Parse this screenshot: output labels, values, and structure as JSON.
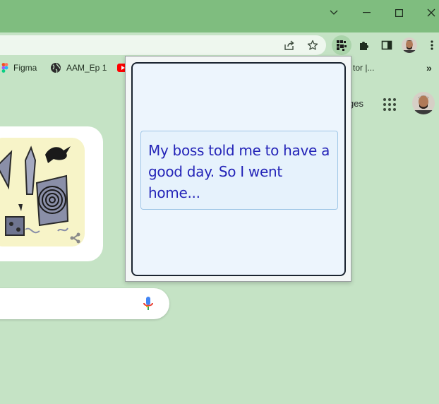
{
  "browser": {
    "window_controls": [
      "tab-search",
      "minimize",
      "maximize",
      "close"
    ],
    "toolbar_icons": [
      "share-icon",
      "star-icon",
      "extension-active-icon",
      "puzzle-icon",
      "side-panel-icon",
      "profile-avatar",
      "kebab-menu-icon"
    ]
  },
  "bookmarks": {
    "items": [
      {
        "label": "Figma",
        "icon": "figma-icon"
      },
      {
        "label": "AAM_Ep 1",
        "icon": "globe-icon"
      },
      {
        "label": "",
        "icon": "youtube-icon"
      }
    ],
    "partial_label": "tor |...",
    "overflow": "»"
  },
  "page": {
    "images_link": "ges"
  },
  "popup": {
    "joke": "My boss told me to have a good day. So I went home..."
  },
  "colors": {
    "titlebar": "#7fbd7f",
    "page_bg": "#c5e3c5",
    "joke_text": "#2424b8",
    "popup_border": "#1b2430"
  }
}
